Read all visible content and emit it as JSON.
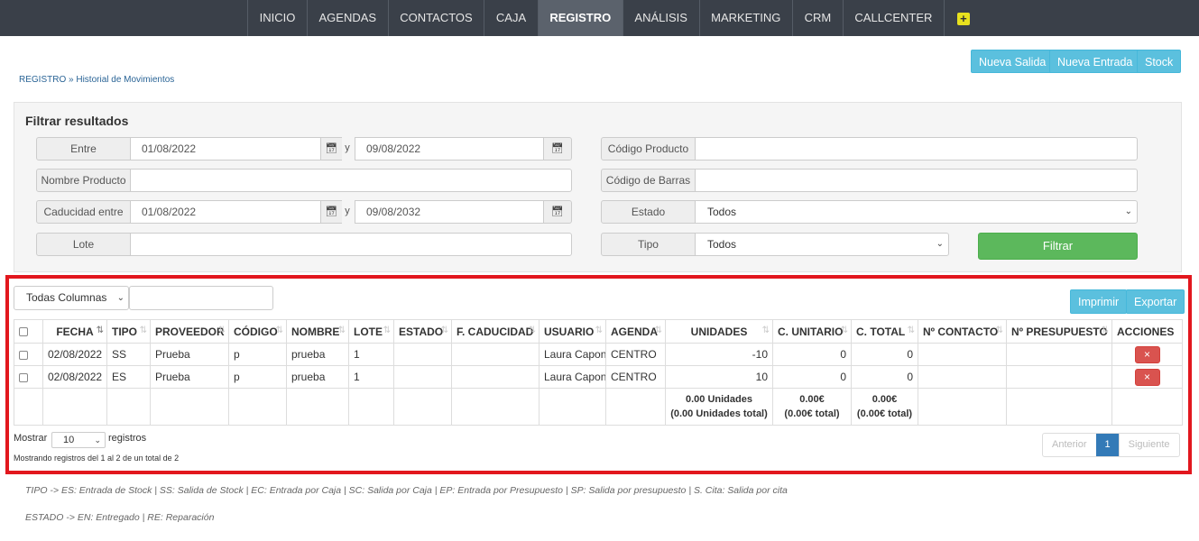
{
  "nav": [
    "INICIO",
    "AGENDAS",
    "CONTACTOS",
    "CAJA",
    "REGISTRO",
    "ANÁLISIS",
    "MARKETING",
    "CRM",
    "CALLCENTER"
  ],
  "nav_active": "REGISTRO",
  "actions": {
    "nueva_salida": "Nueva Salida",
    "nueva_entrada": "Nueva Entrada",
    "stock": "Stock"
  },
  "breadcrumb": {
    "root": "REGISTRO",
    "sep": "»",
    "current": "Historial de Movimientos"
  },
  "filter": {
    "title": "Filtrar resultados",
    "entre_label": "Entre",
    "entre_from": "01/08/2022",
    "entre_to": "09/08/2022",
    "y": "y",
    "nombre_label": "Nombre Producto",
    "caducidad_label": "Caducidad entre",
    "caducidad_from": "01/08/2022",
    "caducidad_to": "09/08/2032",
    "lote_label": "Lote",
    "codigo_label": "Código Producto",
    "barras_label": "Código de Barras",
    "estado_label": "Estado",
    "estado_value": "Todos",
    "tipo_label": "Tipo",
    "tipo_value": "Todos",
    "submit": "Filtrar"
  },
  "table_tools": {
    "column_select": "Todas Columnas",
    "imprimir": "Imprimir",
    "exportar": "Exportar"
  },
  "table": {
    "headers": [
      "FECHA",
      "TIPO",
      "PROVEEDOR",
      "CÓDIGO",
      "NOMBRE",
      "LOTE",
      "ESTADO",
      "F. CADUCIDAD",
      "USUARIO",
      "AGENDA",
      "UNIDADES",
      "C. UNITARIO",
      "C. TOTAL",
      "Nº CONTACTO",
      "Nº PRESUPUESTO",
      "ACCIONES"
    ],
    "rows": [
      {
        "fecha": "02/08/2022",
        "tipo": "SS",
        "proveedor": "Prueba",
        "codigo": "p",
        "nombre": "prueba",
        "lote": "1",
        "estado": "",
        "caducidad": "",
        "usuario": "Laura Capon",
        "agenda": "CENTRO",
        "unidades": "-10",
        "unitario": "0",
        "total": "0",
        "contacto": "",
        "presupuesto": ""
      },
      {
        "fecha": "02/08/2022",
        "tipo": "ES",
        "proveedor": "Prueba",
        "codigo": "p",
        "nombre": "prueba",
        "lote": "1",
        "estado": "",
        "caducidad": "",
        "usuario": "Laura Capon",
        "agenda": "CENTRO",
        "unidades": "10",
        "unitario": "0",
        "total": "0",
        "contacto": "",
        "presupuesto": ""
      }
    ],
    "totals": {
      "unidades": "0.00 Unidades",
      "unidades_total": "(0.00 Unidades total)",
      "unitario": "0.00€",
      "unitario_total": "(0.00€ total)",
      "total": "0.00€",
      "total_total": "(0.00€ total)"
    },
    "delete_symbol": "×"
  },
  "paging": {
    "mostrar": "Mostrar",
    "length": "10",
    "registros": "registros",
    "info": "Mostrando registros del 1 al 2 de un total de 2",
    "anterior": "Anterior",
    "page": "1",
    "siguiente": "Siguiente"
  },
  "legend": {
    "tipo": "TIPO -> ES: Entrada de Stock | SS: Salida de Stock | EC: Entrada por Caja | SC: Salida por Caja | EP: Entrada por Presupuesto | SP: Salida por presupuesto | S. Cita: Salida por cita",
    "estado": "ESTADO -> EN: Entregado | RE: Reparación"
  },
  "colors": {
    "nav_bg": "#3a4049",
    "info_button": "#5bc0de",
    "success": "#5cb85c",
    "danger": "#d9534f",
    "highlight_frame": "#e2171e",
    "primary": "#337ab7"
  }
}
